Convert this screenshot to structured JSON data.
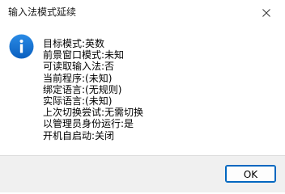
{
  "window": {
    "title": "输入法模式延续",
    "close_icon": "close-icon"
  },
  "dialog": {
    "icon": "info-icon",
    "icon_color": "#0c6fd0",
    "lines": [
      "目标模式:英数",
      "前景窗口模式:未知",
      "可读取输入法:否",
      "当前程序:(未知)",
      "绑定语言:(无规则)",
      "实际语言:(未知)",
      "上次切换尝试:无需切换",
      "以管理员身份运行:是",
      "开机自启动:关闭"
    ]
  },
  "footer": {
    "ok_label": "OK",
    "accent": "#0067c0"
  }
}
